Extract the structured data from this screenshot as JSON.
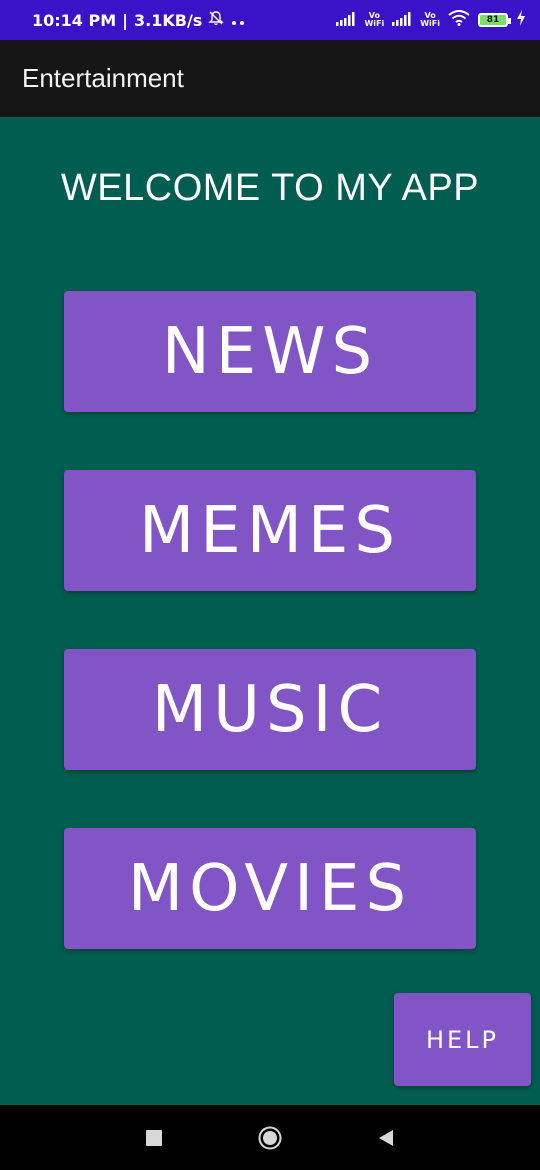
{
  "status_bar": {
    "time": "10:14 PM",
    "speed": "3.1KB/s",
    "net1_label": "Vo\nWiFi",
    "net2_label": "Vo\nWiFi",
    "battery_level": "81",
    "icons": [
      "bell-off-icon",
      "dots-icon",
      "signal-icon",
      "signal-icon",
      "wifi-icon",
      "battery-icon",
      "charging-icon"
    ]
  },
  "app_bar": {
    "title": "Entertainment"
  },
  "main": {
    "welcome": "WELCOME TO MY APP",
    "buttons": [
      {
        "label": "NEWS"
      },
      {
        "label": "MEMES"
      },
      {
        "label": "MUSIC"
      },
      {
        "label": "MOVIES"
      }
    ],
    "help_label": "HELP"
  },
  "nav_bar": {
    "icons": [
      "recents-icon",
      "home-icon",
      "back-icon"
    ]
  },
  "colors": {
    "status_bar": "#3a13c8",
    "app_bar": "#161616",
    "background": "#015d4f",
    "button": "#8155c5"
  }
}
